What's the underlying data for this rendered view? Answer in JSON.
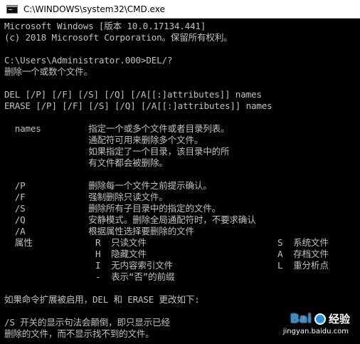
{
  "window": {
    "title": "C:\\WINDOWS\\system32\\CMD.exe"
  },
  "console": {
    "lines": [
      "Microsoft Windows [版本 10.0.17134.441]",
      "(c) 2018 Microsoft Corporation。保留所有权利。",
      "",
      "C:\\Users\\Administrator.000>DEL/?",
      "删除一个或数个文件。",
      "",
      "DEL [/P] [/F] [/S] [/Q] [/A[[:]attributes]] names",
      "ERASE [/P] [/F] [/S] [/Q] [/A[[:]attributes]] names",
      "",
      "  names         指定一个或多个文件或者目录列表。",
      "                通配符可用来删除多个文件。",
      "                如果指定了一个目录，该目录中的所",
      "                有文件都会被删除。",
      "",
      "  /P            删除每一个文件之前提示确认。",
      "  /F            强制删除只读文件。",
      "  /S            删除所有子目录中的指定的文件。",
      "  /Q            安静模式。删除全局通配符时，不要求确认",
      "  /A            根据属性选择要删除的文件"
    ],
    "attributes": {
      "label": "  属性",
      "rows": [
        {
          "left": "R  只读文件",
          "right": "S  系统文件"
        },
        {
          "left": "H  隐藏文件",
          "right": "A  存档文件"
        },
        {
          "left": "I  无内容索引文件",
          "right": "L  重分析点"
        },
        {
          "left": "-  表示“否”的前缀",
          "right": ""
        }
      ]
    },
    "tail": [
      "",
      "如果命令扩展被启用，DEL 和 ERASE 更改如下:",
      "",
      "/S 开关的显示句法会颠倒，即只显示已经",
      "删除的文件，而不显示找不到的文件。"
    ]
  },
  "watermark": {
    "logo": "Bai",
    "logo_suffix": "经验",
    "url": "jingyan.baidu.com"
  }
}
